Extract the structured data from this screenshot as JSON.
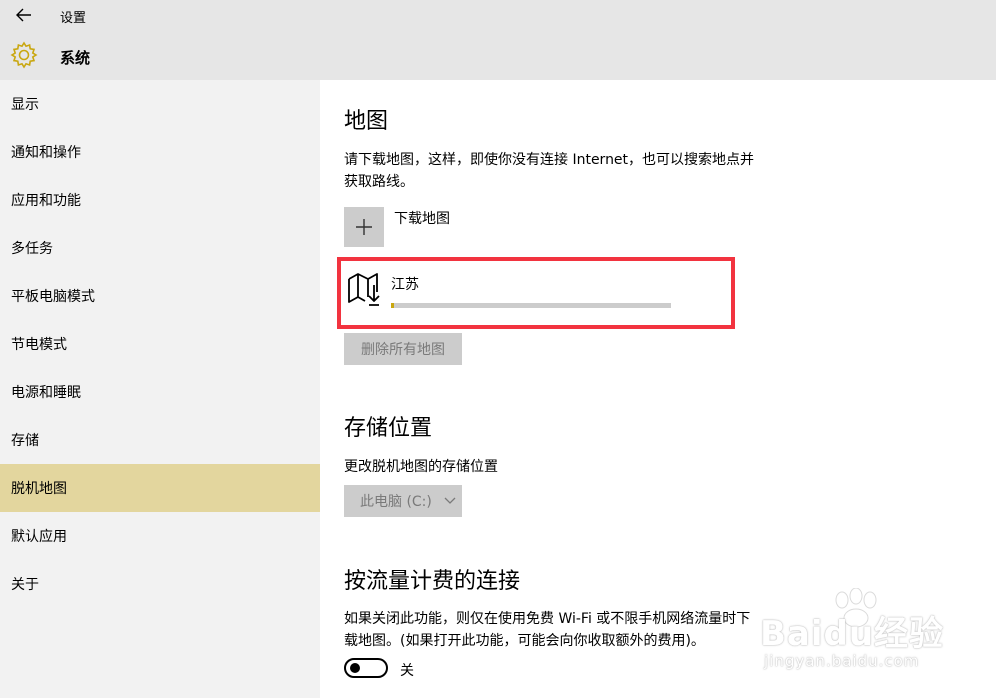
{
  "window": {
    "title": "设置"
  },
  "header": {
    "title": "系统",
    "icon": "gear-icon",
    "accent": "#c9a70f"
  },
  "sidebar": {
    "items": [
      {
        "label": "显示",
        "selected": false
      },
      {
        "label": "通知和操作",
        "selected": false
      },
      {
        "label": "应用和功能",
        "selected": false
      },
      {
        "label": "多任务",
        "selected": false
      },
      {
        "label": "平板电脑模式",
        "selected": false
      },
      {
        "label": "节电模式",
        "selected": false
      },
      {
        "label": "电源和睡眠",
        "selected": false
      },
      {
        "label": "存储",
        "selected": false
      },
      {
        "label": "脱机地图",
        "selected": true
      },
      {
        "label": "默认应用",
        "selected": false
      },
      {
        "label": "关于",
        "selected": false
      }
    ],
    "selected_color": "#e3d69e"
  },
  "maps": {
    "heading": "地图",
    "description_line1": "请下载地图，这样，即使你没有连接 Internet，也可以搜索地点并",
    "description_line2": "获取路线。",
    "download_label": "下载地图",
    "entry": {
      "name": "江苏",
      "progress": 0.01,
      "highlight_color": "#f2333f"
    },
    "delete_all_label": "删除所有地图"
  },
  "storage": {
    "heading": "存储位置",
    "description": "更改脱机地图的存储位置",
    "selected_location": "此电脑 (C:)"
  },
  "metered": {
    "heading": "按流量计费的连接",
    "description_line1": "如果关闭此功能，则仅在使用免费 Wi-Fi 或不限手机网络流量时下",
    "description_line2": "载地图。(如果打开此功能，可能会向你收取额外的费用)。",
    "toggle_state": "关",
    "toggle_on": false
  },
  "watermark": {
    "brand": "Baidu经验",
    "url": "jingyan.baidu.com"
  }
}
